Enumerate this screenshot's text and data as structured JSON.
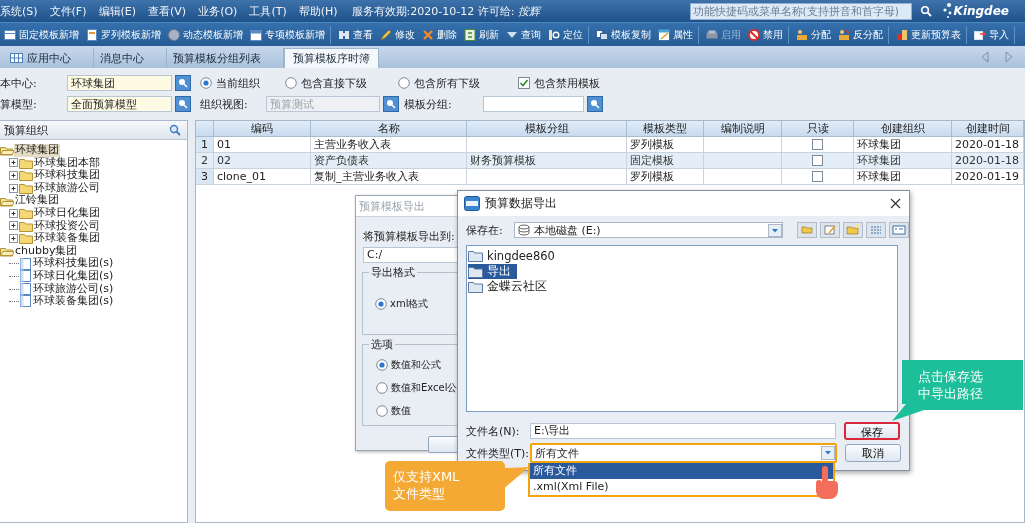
{
  "menu_bar": {
    "menus": [
      "系统(S)",
      "文件(F)",
      "编辑(E)",
      "查看(V)",
      "业务(O)",
      "工具(T)",
      "帮助(H)"
    ],
    "service_info": "服务有效期:2020-10-12 许可给:",
    "licensee": "按辉",
    "search": {
      "placeholder": "功能快捷码或菜单名称(支持拼音和首字母)"
    },
    "logo": "Kingdee"
  },
  "toolbar": {
    "groups": [
      {
        "buttons": [
          {
            "label": "固定模板新增",
            "disabled": false
          },
          {
            "label": "罗列模板新增",
            "disabled": false
          },
          {
            "label": "动态模板新增",
            "disabled": false
          },
          {
            "label": "专项模板新增",
            "disabled": false
          }
        ]
      },
      {
        "buttons": [
          {
            "label": "查看",
            "disabled": false
          },
          {
            "label": "修改",
            "disabled": false
          },
          {
            "label": "删除",
            "disabled": false
          },
          {
            "label": "刷新",
            "disabled": false
          },
          {
            "label": "查询",
            "disabled": false
          },
          {
            "label": "定位",
            "disabled": false
          }
        ]
      },
      {
        "buttons": [
          {
            "label": "模板复制",
            "disabled": false
          },
          {
            "label": "属性",
            "disabled": false
          }
        ]
      },
      {
        "buttons": [
          {
            "label": "启用",
            "disabled": true
          },
          {
            "label": "禁用",
            "disabled": false
          }
        ]
      },
      {
        "buttons": [
          {
            "label": "分配",
            "disabled": false
          },
          {
            "label": "反分配",
            "disabled": false
          }
        ]
      },
      {
        "buttons": [
          {
            "label": "更新预算表",
            "disabled": false
          }
        ]
      },
      {
        "buttons": [
          {
            "label": "导入",
            "disabled": false
          }
        ]
      }
    ]
  },
  "tabs": [
    {
      "label": "应用中心",
      "selected": false
    },
    {
      "label": "消息中心",
      "selected": false
    },
    {
      "label": "预算模板分组列表",
      "selected": false
    },
    {
      "label": "预算模板序时簿",
      "selected": true
    }
  ],
  "filters": {
    "cost_center": {
      "label": "本中心:",
      "value": "环球集团"
    },
    "budget_model": {
      "label": "算模型:",
      "value": "全面预算模型"
    },
    "scope_options": [
      {
        "label": "当前组织",
        "selected": true
      },
      {
        "label": "包含直接下级",
        "selected": false
      },
      {
        "label": "包含所有下级",
        "selected": false
      }
    ],
    "include_disabled": {
      "label": "包含禁用模板",
      "checked": true
    },
    "org_view": {
      "label": "组织视图:",
      "value": "预算测试",
      "disabled": true
    },
    "template_group": {
      "label": "模板分组:",
      "disabled": false
    }
  },
  "tree": {
    "title": "预算组织",
    "nodes": [
      {
        "label": "环球集团",
        "kind": "folder",
        "expanded": true,
        "selected": true,
        "children": [
          {
            "label": "环球集团本部",
            "kind": "folder",
            "expanded": false,
            "selected": false
          },
          {
            "label": "环球科技集团",
            "kind": "folder",
            "expanded": false,
            "selected": false
          },
          {
            "label": "环球旅游公司",
            "kind": "folder",
            "expanded": false,
            "selected": false
          }
        ]
      },
      {
        "label": "江铃集团",
        "kind": "folder",
        "expanded": true,
        "selected": false,
        "children": [
          {
            "label": "环球日化集团",
            "kind": "folder",
            "expanded": false,
            "selected": false
          },
          {
            "label": "环球投资公司",
            "kind": "folder",
            "expanded": false,
            "selected": false
          },
          {
            "label": "环球装备集团",
            "kind": "folder",
            "expanded": false,
            "selected": false
          }
        ]
      },
      {
        "label": "chubby集团",
        "kind": "folder",
        "expanded": true,
        "selected": false,
        "children": [
          {
            "label": "环球科技集团(s)",
            "kind": "leaf",
            "selected": false
          },
          {
            "label": "环球日化集团(s)",
            "kind": "leaf",
            "selected": false
          },
          {
            "label": "环球旅游公司(s)",
            "kind": "leaf",
            "selected": false
          },
          {
            "label": "环球装备集团(s)",
            "kind": "leaf",
            "selected": false
          }
        ]
      }
    ]
  },
  "table": {
    "columns": [
      "编码",
      "名称",
      "模板分组",
      "模板类型",
      "编制说明",
      "只读",
      "创建组织",
      "创建时间"
    ],
    "rows": [
      {
        "index": "1",
        "code": "01",
        "name": "主营业务收入表",
        "type": "罗列模板",
        "readonly": false,
        "org": "环球集团",
        "created": "2020-01-18",
        "selected": false
      },
      {
        "index": "2",
        "code": "02",
        "name": "资产负债表",
        "group": "财务预算模板",
        "type": "固定模板",
        "readonly": false,
        "org": "环球集团",
        "created": "2020-01-18",
        "selected": true
      },
      {
        "index": "3",
        "code": "clone_01",
        "name": "复制_主营业务收入表",
        "type": "罗列模板",
        "readonly": false,
        "org": "环球集团",
        "created": "2020-01-19",
        "selected": false
      }
    ]
  },
  "template_export_dialog": {
    "title": "预算模板导出",
    "path_label": "将预算模板导出到:",
    "path": "C:/",
    "format_group": {
      "title": "导出格式",
      "options": [
        {
          "label": "xml格式",
          "selected": true
        }
      ]
    },
    "options_group": {
      "title": "选项",
      "options": [
        {
          "label": "数值和公式",
          "selected": true
        },
        {
          "label": "数值和Excel公",
          "selected": false
        },
        {
          "label": "数值",
          "selected": false
        }
      ]
    }
  },
  "save_dialog": {
    "title": "预算数据导出",
    "look_in_label": "保存在:",
    "look_in": "本地磁盘 (E:)",
    "files": [
      {
        "name": "kingdee860",
        "selected": false
      },
      {
        "name": "导出",
        "selected": true
      },
      {
        "name": "金蝶云社区",
        "selected": false
      }
    ],
    "file_name_label": "文件名(N):",
    "file_name": "E:\\导出",
    "file_type_label": "文件类型(T):",
    "file_type": "所有文件",
    "file_type_options": [
      {
        "label": "所有文件",
        "selected": true
      },
      {
        "label": ".xml(Xml File)",
        "selected": false
      }
    ],
    "buttons": [
      {
        "label": "保存",
        "highlighted": true
      },
      {
        "label": "取消",
        "highlighted": false
      }
    ]
  },
  "callouts": [
    {
      "text": "点击保存选中导出路径",
      "color": "#1dbf9a"
    },
    {
      "text": "仅支持XML文件类型",
      "color": "#f5a935"
    }
  ]
}
